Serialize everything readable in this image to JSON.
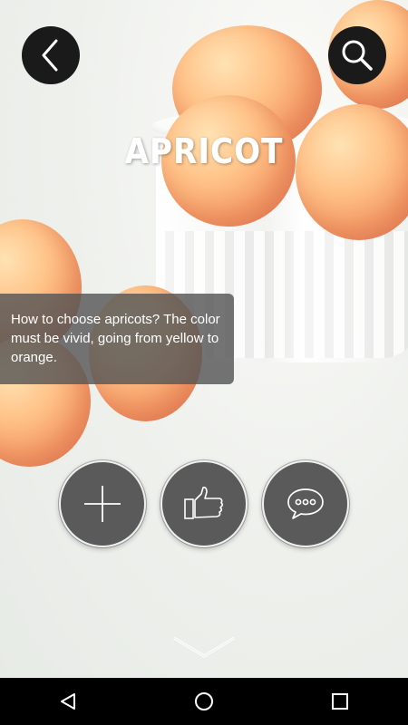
{
  "app": {
    "title": "APRICOT",
    "description": "How to choose apricots? The color must be vivid, going from yellow to orange."
  },
  "header": {
    "back_icon": "chevron-left-icon",
    "search_icon": "search-icon"
  },
  "actions": [
    {
      "name": "add",
      "icon": "plus-icon"
    },
    {
      "name": "like",
      "icon": "thumbs-up-icon"
    },
    {
      "name": "comment",
      "icon": "speech-bubble-icon"
    }
  ],
  "footer": {
    "expand_icon": "chevron-down-icon"
  },
  "system_nav": {
    "back": "triangle-back-icon",
    "home": "circle-home-icon",
    "recents": "square-recents-icon"
  },
  "colors": {
    "overlay": "#555555",
    "button_dark": "#1a1a1a",
    "action_fill": "#5a5a5a",
    "navbar": "#000000"
  }
}
